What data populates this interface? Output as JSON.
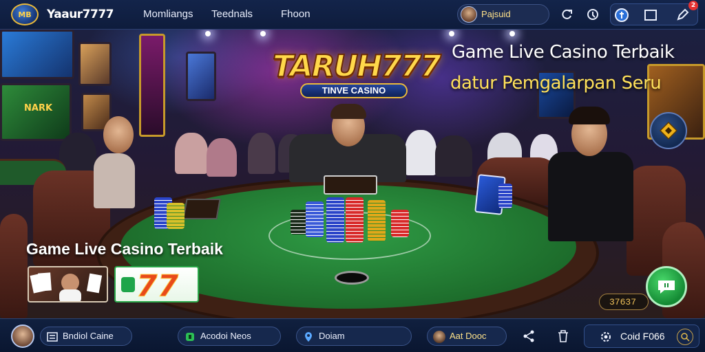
{
  "header": {
    "logo_text": "MB",
    "brand": "Yaaur7777",
    "nav": [
      "Momliangs",
      "Teednals",
      "Fhoon"
    ],
    "user_name": "Pajsuid",
    "notification_count": "2"
  },
  "hero": {
    "logo_title": "TARUH777",
    "logo_subtitle": "TINVE CASINO",
    "headline_line1": "Game Live Casino Terbaik",
    "headline_line2": "datur Pemgalarpan Seru",
    "screen_label": "NARK",
    "promo_title": "Game Live Casino Terbaik",
    "promo_badge": "77",
    "code": "37637"
  },
  "bottom_bar": {
    "items": [
      {
        "label": "Bndiol Caine",
        "icon": "list-icon"
      },
      {
        "label": "Acodoi Neos",
        "icon": "game-icon"
      },
      {
        "label": "Doiam",
        "icon": "location-icon"
      },
      {
        "label": "Aat Dooc",
        "icon": "avatar"
      }
    ],
    "gold_label": "Coid F066"
  },
  "colors": {
    "accent_gold": "#ffd84a",
    "felt_green": "#2f9c45",
    "bar_navy": "#10203f",
    "chat_green": "#2cbf55"
  }
}
